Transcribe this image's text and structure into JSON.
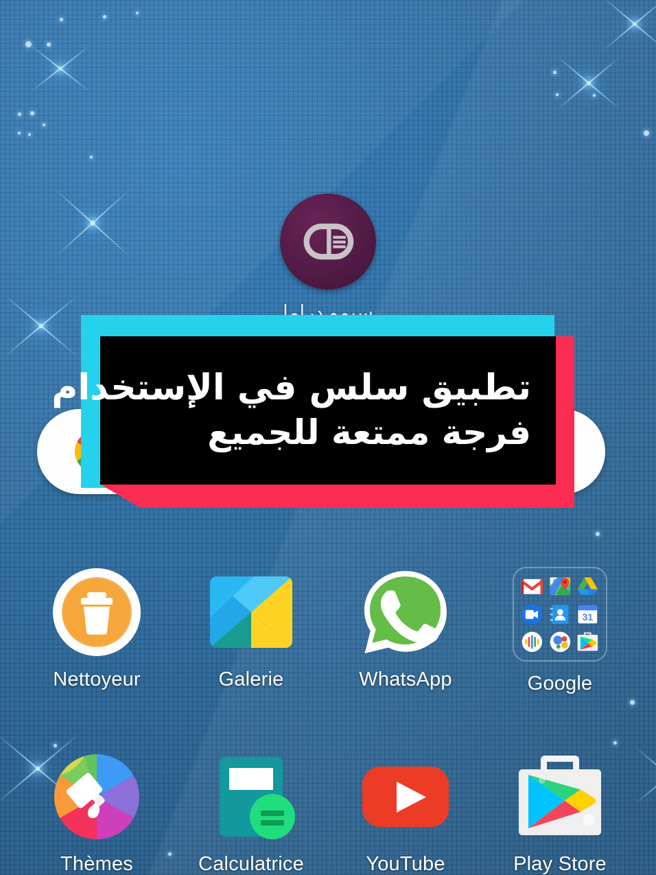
{
  "wallpaper": {
    "description": "blue-grid-starfield-wallpaper",
    "base_color": "#27699f",
    "grid_color": "#1f5785"
  },
  "promo_banner": {
    "line1": "تطبيق سلس في الإستخدام",
    "line2": "فرجة ممتعة للجميع",
    "colors": {
      "cyan": "#25d2ec",
      "pink": "#fb2c51",
      "panel": "#000000",
      "text": "#ffffff"
    }
  },
  "featured_app": {
    "label": "سيمو دراما",
    "icon": "cd-monogram-icon",
    "badge_color": "#551d49"
  },
  "search_widget": {
    "icon": "google-g-icon",
    "placeholder": "",
    "value": ""
  },
  "home_rows": [
    {
      "apps": [
        {
          "label": "Nettoyeur",
          "icon": "trash-bin-icon"
        },
        {
          "label": "Galerie",
          "icon": "gallery-icon"
        },
        {
          "label": "WhatsApp",
          "icon": "whatsapp-icon"
        },
        {
          "label": "Google",
          "icon": "google-folder-icon"
        }
      ]
    },
    {
      "apps": [
        {
          "label": "Thèmes",
          "icon": "themes-paintbrush-icon"
        },
        {
          "label": "Calculatrice",
          "icon": "calculator-icon"
        },
        {
          "label": "YouTube",
          "icon": "youtube-icon"
        },
        {
          "label": "Play Store",
          "icon": "play-store-icon"
        }
      ]
    }
  ],
  "google_folder": {
    "apps": [
      {
        "label": "Gmail",
        "icon": "gmail-icon"
      },
      {
        "label": "Maps",
        "icon": "maps-icon"
      },
      {
        "label": "Drive",
        "icon": "drive-icon"
      },
      {
        "label": "Duo",
        "icon": "duo-icon"
      },
      {
        "label": "Contacts",
        "icon": "contacts-icon"
      },
      {
        "label": "Agenda",
        "icon": "calendar-31-icon"
      },
      {
        "label": "Podcasts",
        "icon": "podcasts-icon"
      },
      {
        "label": "Assistant",
        "icon": "assistant-icon"
      },
      {
        "label": "Play Store",
        "icon": "play-store-mini-icon"
      }
    ],
    "calendar_day": "31"
  }
}
